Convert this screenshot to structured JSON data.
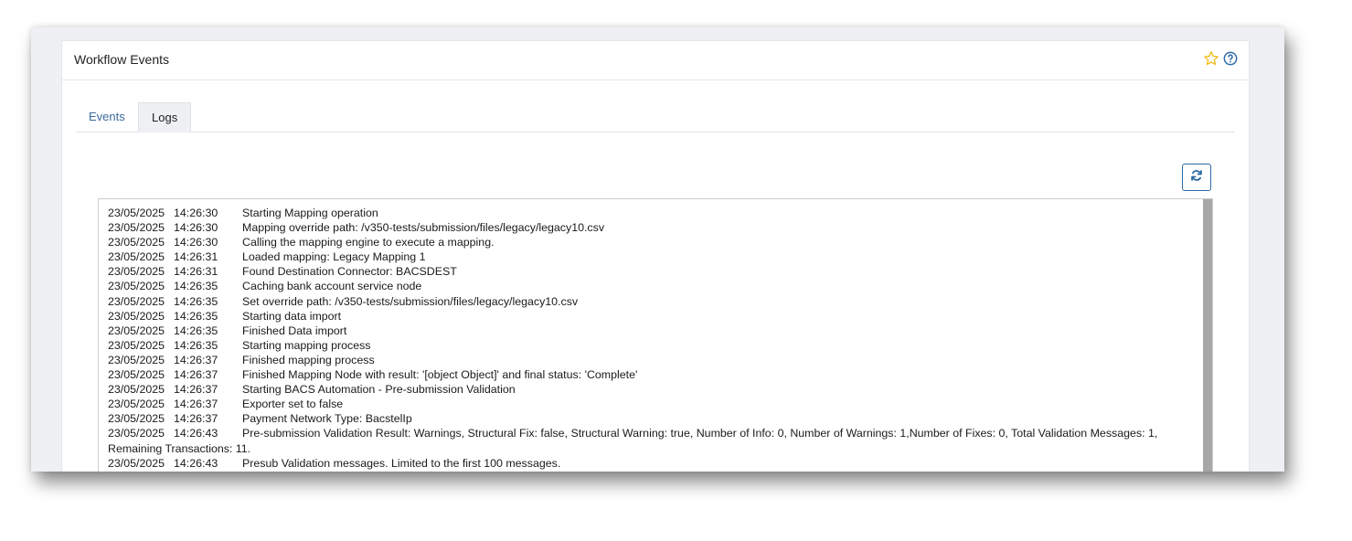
{
  "card": {
    "title": "Workflow Events"
  },
  "icons": {
    "favorite": "star-icon",
    "help": "help-icon",
    "refresh": "refresh-icon"
  },
  "tabs": [
    {
      "label": "Events",
      "active": false
    },
    {
      "label": "Logs",
      "active": true
    }
  ],
  "logs": [
    {
      "date": "23/05/2025",
      "time": "14:26:30",
      "message": "Starting Mapping operation"
    },
    {
      "date": "23/05/2025",
      "time": "14:26:30",
      "message": "Mapping override path: /v350-tests/submission/files/legacy/legacy10.csv"
    },
    {
      "date": "23/05/2025",
      "time": "14:26:30",
      "message": "Calling the mapping engine to execute a mapping."
    },
    {
      "date": "23/05/2025",
      "time": "14:26:31",
      "message": "Loaded mapping: Legacy Mapping 1"
    },
    {
      "date": "23/05/2025",
      "time": "14:26:31",
      "message": "Found Destination Connector: BACSDEST"
    },
    {
      "date": "23/05/2025",
      "time": "14:26:35",
      "message": "Caching bank account service node"
    },
    {
      "date": "23/05/2025",
      "time": "14:26:35",
      "message": "Set override path: /v350-tests/submission/files/legacy/legacy10.csv"
    },
    {
      "date": "23/05/2025",
      "time": "14:26:35",
      "message": "Starting data import"
    },
    {
      "date": "23/05/2025",
      "time": "14:26:35",
      "message": "Finished Data import"
    },
    {
      "date": "23/05/2025",
      "time": "14:26:35",
      "message": "Starting mapping process"
    },
    {
      "date": "23/05/2025",
      "time": "14:26:37",
      "message": "Finished mapping process"
    },
    {
      "date": "23/05/2025",
      "time": "14:26:37",
      "message": "Finished Mapping Node with result: '[object Object]' and final status: 'Complete'"
    },
    {
      "date": "23/05/2025",
      "time": "14:26:37",
      "message": "Starting BACS Automation - Pre-submission Validation"
    },
    {
      "date": "23/05/2025",
      "time": "14:26:37",
      "message": "Exporter set to false"
    },
    {
      "date": "23/05/2025",
      "time": "14:26:37",
      "message": "Payment Network Type: BacstelIp"
    },
    {
      "date": "23/05/2025",
      "time": "14:26:43",
      "message": "Pre-submission Validation Result: Warnings, Structural Fix: false, Structural Warning: true, Number of Info: 0, Number of Warnings: 1,Number of Fixes: 0, Total Validation Messages: 1, Remaining Transactions: 11."
    },
    {
      "date": "23/05/2025",
      "time": "14:26:43",
      "message": "Presub Validation messages.  Limited to the first 100 messages."
    }
  ]
}
